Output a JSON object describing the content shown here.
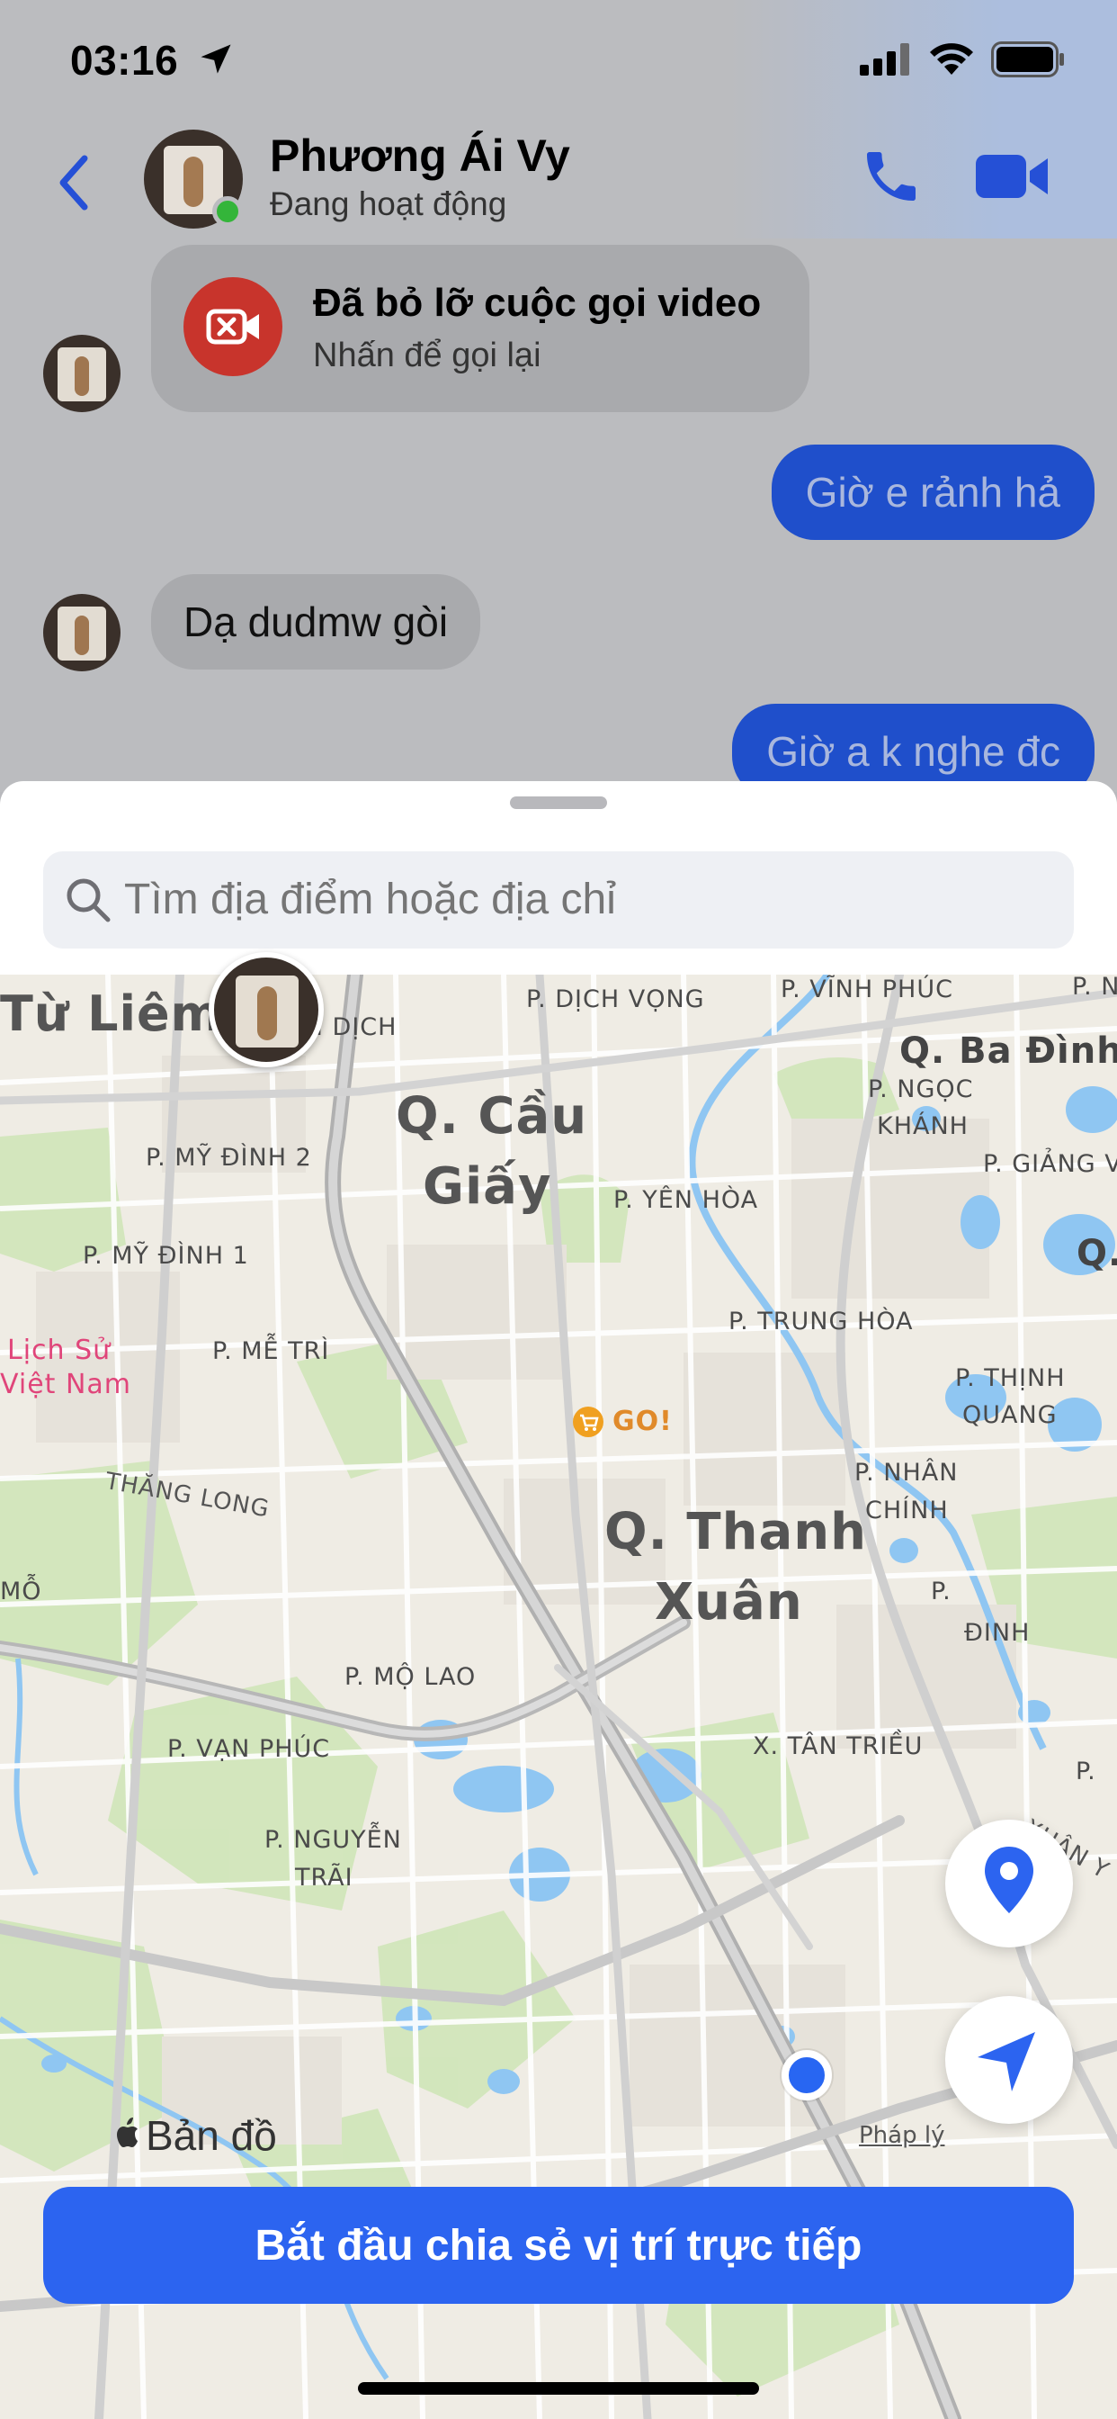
{
  "status_bar": {
    "time": "03:16"
  },
  "header": {
    "contact_name": "Phương Ái Vy",
    "contact_status": "Đang hoạt động"
  },
  "messages": {
    "missed_call_title": "Đã bỏ lỡ cuộc gọi video",
    "missed_call_sub": "Nhấn để gọi lại",
    "msg1": "Giờ e rảnh hả",
    "msg2": "Dạ dudmw gòi",
    "msg3": "Giờ a k nghe đc"
  },
  "search": {
    "placeholder": "Tìm địa điểm hoặc địa chỉ"
  },
  "map": {
    "labels": {
      "tu_liem": "Từ Liêm",
      "mai_dich": "P. MAI DỊCH",
      "dich_vong": "P. DỊCH VỌNG",
      "vinh_phuc": "P. VĨNH PHÚC",
      "p_n": "P. N",
      "ba_dinh": "Q. Ba Đình",
      "cau_giay_1": "Q. Cầu",
      "cau_giay_2": "Giấy",
      "ngoc_khanh_1": "P. NGỌC",
      "ngoc_khanh_2": "KHÁNH",
      "my_dinh_2": "P. MỸ ĐÌNH 2",
      "giang_vo": "P. GIẢNG VÕ",
      "yen_hoa": "P. YÊN HÒA",
      "my_dinh_1": "P. MỸ ĐÌNH 1",
      "q_edge": "Q.",
      "trung_hoa": "P. TRUNG HÒA",
      "lich_su_1": "Lịch Sử",
      "lich_su_2": "Việt Nam",
      "me_tri": "P. MỄ TRÌ",
      "thinh_quang_1": "P. THỊNH",
      "thinh_quang_2": "QUANG",
      "go": "GO!",
      "thang_long": "THĂNG LONG",
      "nhan_chinh_1": "P. NHÂN",
      "nhan_chinh_2": "CHÍNH",
      "thanh_xuan_1": "Q. Thanh",
      "thanh_xuan_2": "Xuân",
      "mo": "MỖ",
      "p_right": "P.",
      "dinh_right": "ĐINH",
      "mo_lao": "P. MỘ LAO",
      "van_phuc": "P. VẠN PHÚC",
      "tan_trieu": "X. TÂN TRIỀU",
      "p_bottom_right": "P.",
      "nguyen_trai_1": "P. NGUYỄN",
      "nguyen_trai_2": "TRÃI",
      "xuan_y": "XUÂN Y"
    },
    "attribution": "Bản đồ",
    "legal": "Pháp lý"
  },
  "share_button": "Bắt đầu chia sẻ vị trí trực tiếp",
  "colors": {
    "accent": "#2c64f0",
    "online": "#34b53a",
    "missed": "#c8342c"
  }
}
